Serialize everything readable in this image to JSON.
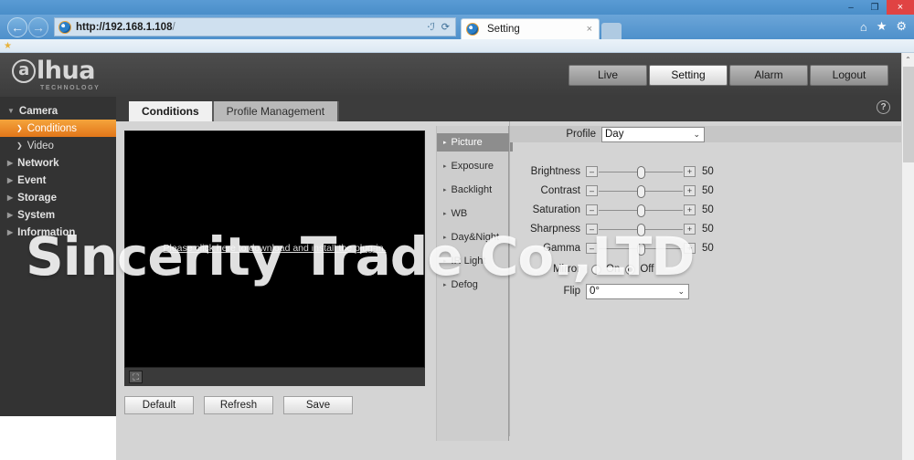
{
  "browser": {
    "url_bold": "http://192.168.1.108",
    "url_tail": "/",
    "search_icon": "search-icon",
    "refresh_icon": "refresh-icon",
    "back_arrow": "←",
    "forward_arrow": "→",
    "tab_title": "Setting",
    "tab_close": "×",
    "minimize": "–",
    "maximize": "❐",
    "close": "×",
    "home_icon": "⌂",
    "favorites_icon": "★",
    "tools_icon": "⚙"
  },
  "app": {
    "logo_initial": "a",
    "logo_text": "lhua",
    "logo_sub": "TECHNOLOGY",
    "topnav": [
      {
        "label": "Live",
        "active": false
      },
      {
        "label": "Setting",
        "active": true
      },
      {
        "label": "Alarm",
        "active": false
      },
      {
        "label": "Logout",
        "active": false
      }
    ],
    "help_glyph": "?"
  },
  "sidebar": {
    "items": [
      {
        "label": "Camera",
        "caret": "▼",
        "level": "top",
        "active": false
      },
      {
        "label": "Conditions",
        "caret": "❯",
        "level": "sub",
        "active": true
      },
      {
        "label": "Video",
        "caret": "❯",
        "level": "sub",
        "active": false
      },
      {
        "label": "Network",
        "caret": "▶",
        "level": "top",
        "active": false
      },
      {
        "label": "Event",
        "caret": "▶",
        "level": "top",
        "active": false
      },
      {
        "label": "Storage",
        "caret": "▶",
        "level": "top",
        "active": false
      },
      {
        "label": "System",
        "caret": "▶",
        "level": "top",
        "active": false
      },
      {
        "label": "Information",
        "caret": "▶",
        "level": "top",
        "active": false
      }
    ]
  },
  "tabs": [
    {
      "label": "Conditions",
      "active": true
    },
    {
      "label": "Profile Management",
      "active": false
    }
  ],
  "video": {
    "plugin_message": "Please click here to download and install the plug-in.",
    "expand_icon": "⛶"
  },
  "buttons": [
    {
      "label": "Default"
    },
    {
      "label": "Refresh"
    },
    {
      "label": "Save"
    }
  ],
  "submenu": {
    "items": [
      {
        "label": "Picture",
        "active": true
      },
      {
        "label": "Exposure",
        "active": false
      },
      {
        "label": "Backlight",
        "active": false
      },
      {
        "label": "WB",
        "active": false
      },
      {
        "label": "Day&Night",
        "active": false
      },
      {
        "label": "IR Light",
        "active": false
      },
      {
        "label": "Defog",
        "active": false
      }
    ],
    "caret": "▸"
  },
  "settings": {
    "profile_label": "Profile",
    "profile_value": "Day",
    "dropdown_arrow": "⌄",
    "minus": "–",
    "plus": "+",
    "sliders": [
      {
        "label": "Brightness",
        "value": "50"
      },
      {
        "label": "Contrast",
        "value": "50"
      },
      {
        "label": "Saturation",
        "value": "50"
      },
      {
        "label": "Sharpness",
        "value": "50"
      },
      {
        "label": "Gamma",
        "value": "50"
      }
    ],
    "mirror_label": "Mirror",
    "mirror_on": "On",
    "mirror_off": "Off",
    "mirror_selected": "Off",
    "flip_label": "Flip",
    "flip_value": "0°"
  },
  "watermark": {
    "text": "Sincerity Trade Co.,LTD"
  },
  "scrollbar": {
    "up_arrow": "⌃"
  },
  "colors": {
    "accent_orange": "#e2761a",
    "header_dark": "#3c3c3c",
    "sidebar_dark": "#333333",
    "content_gray": "#d4d4d4"
  }
}
